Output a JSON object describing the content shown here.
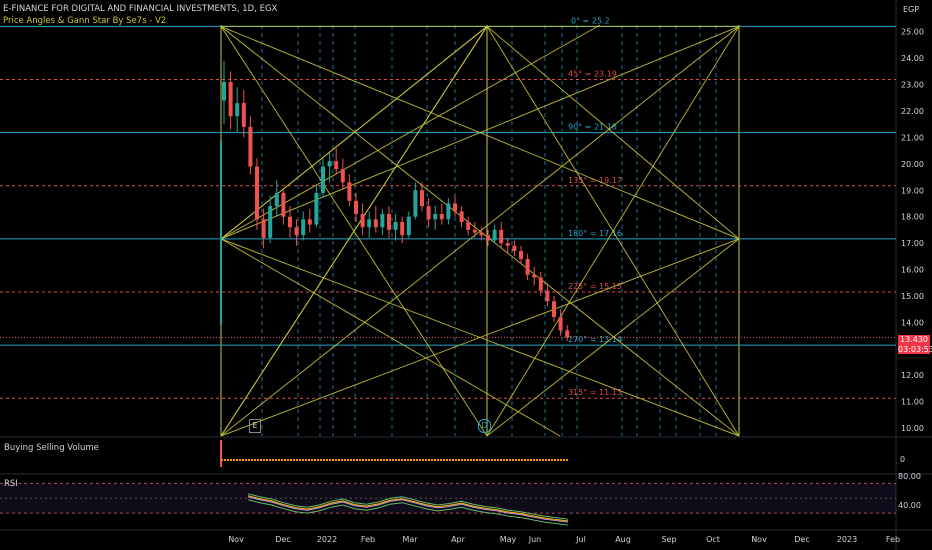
{
  "header": {
    "symbol_title": "E-FINANCE FOR DIGITAL AND FINANCIAL INVESTMENTS, 1D, EGX",
    "indicator_title": "Price Angles & Gann Star By Se7s - V2"
  },
  "currency": "EGP",
  "last_price": {
    "value": "13.430",
    "countdown": "03:03:53"
  },
  "panes": {
    "volume_label": "Buying Selling Volume",
    "volume_zero": "0",
    "rsi_label": "RSI",
    "rsi_ticks": [
      "80.00",
      "40.00"
    ]
  },
  "markers": {
    "event_e": "E",
    "event_d": "D"
  },
  "colors": {
    "background": "#000000",
    "gann_yellow": "#c8c83a",
    "cyan": "#26a6c8",
    "red_dash": "#e04a4a",
    "up": "#26a69a",
    "down": "#ef5350",
    "rsi_purple": "#7e57c2"
  },
  "chart_data": {
    "type": "candlestick",
    "title": "E-FINANCE FOR DIGITAL AND FINANCIAL INVESTMENTS, 1D, EGX",
    "y_unit": "EGP",
    "ylim": [
      9.7,
      26.2
    ],
    "y_ticks": [
      10,
      11,
      12,
      13,
      14,
      15,
      16,
      17,
      18,
      19,
      20,
      21,
      22,
      23,
      24,
      25
    ],
    "x_ticks": [
      "Nov",
      "Dec",
      "2022",
      "Feb",
      "Mar",
      "Apr",
      "May",
      "Jun",
      "Jul",
      "Aug",
      "Sep",
      "Oct",
      "Nov",
      "Dec",
      "2023",
      "Feb"
    ],
    "gann_levels": [
      {
        "label": "0° = 25.2",
        "value": 25.2,
        "color": "#26a6c8",
        "style": "solid"
      },
      {
        "label": "45° = 23.19",
        "value": 23.19,
        "color": "#e04a4a",
        "style": "dashed"
      },
      {
        "label": "90° = 21.18",
        "value": 21.18,
        "color": "#26a6c8",
        "style": "solid"
      },
      {
        "label": "135° = 19.17",
        "value": 19.17,
        "color": "#e04a4a",
        "style": "dashed"
      },
      {
        "label": "180° = 17.16",
        "value": 17.16,
        "color": "#26a6c8",
        "style": "solid"
      },
      {
        "label": "225° = 15.15",
        "value": 15.15,
        "color": "#e04a4a",
        "style": "dashed"
      },
      {
        "label": "270° = 13.14",
        "value": 13.14,
        "color": "#26a6c8",
        "style": "solid"
      },
      {
        "label": "315° = 11.13",
        "value": 11.13,
        "color": "#e04a4a",
        "style": "dashed"
      }
    ],
    "price_series": [
      {
        "x": 0,
        "o": 22.4,
        "h": 23.9,
        "l": 21.5,
        "c": 23.1
      },
      {
        "x": 3,
        "o": 23.1,
        "h": 23.5,
        "l": 21.3,
        "c": 21.8
      },
      {
        "x": 6,
        "o": 21.8,
        "h": 22.9,
        "l": 21.2,
        "c": 22.3
      },
      {
        "x": 9,
        "o": 22.3,
        "h": 22.8,
        "l": 21.0,
        "c": 21.4
      },
      {
        "x": 12,
        "o": 21.4,
        "h": 21.8,
        "l": 19.6,
        "c": 19.9
      },
      {
        "x": 15,
        "o": 19.9,
        "h": 20.2,
        "l": 17.5,
        "c": 17.9
      },
      {
        "x": 18,
        "o": 17.9,
        "h": 18.3,
        "l": 16.8,
        "c": 17.2
      },
      {
        "x": 21,
        "o": 17.2,
        "h": 18.8,
        "l": 17.0,
        "c": 18.4
      },
      {
        "x": 24,
        "o": 18.4,
        "h": 19.4,
        "l": 18.0,
        "c": 18.9
      },
      {
        "x": 27,
        "o": 18.9,
        "h": 19.0,
        "l": 17.7,
        "c": 18.0
      },
      {
        "x": 30,
        "o": 18.0,
        "h": 18.4,
        "l": 17.2,
        "c": 17.6
      },
      {
        "x": 33,
        "o": 17.6,
        "h": 17.9,
        "l": 16.9,
        "c": 17.3
      },
      {
        "x": 36,
        "o": 17.3,
        "h": 18.2,
        "l": 17.1,
        "c": 17.9
      },
      {
        "x": 39,
        "o": 17.9,
        "h": 18.3,
        "l": 17.4,
        "c": 17.7
      },
      {
        "x": 42,
        "o": 17.7,
        "h": 19.2,
        "l": 17.6,
        "c": 18.9
      },
      {
        "x": 45,
        "o": 18.9,
        "h": 20.2,
        "l": 18.7,
        "c": 19.9
      },
      {
        "x": 48,
        "o": 19.9,
        "h": 20.4,
        "l": 19.3,
        "c": 20.1
      },
      {
        "x": 51,
        "o": 20.1,
        "h": 20.6,
        "l": 19.6,
        "c": 19.8
      },
      {
        "x": 54,
        "o": 19.8,
        "h": 20.2,
        "l": 19.0,
        "c": 19.3
      },
      {
        "x": 57,
        "o": 19.3,
        "h": 19.6,
        "l": 18.4,
        "c": 18.6
      },
      {
        "x": 60,
        "o": 18.6,
        "h": 18.9,
        "l": 17.8,
        "c": 18.1
      },
      {
        "x": 63,
        "o": 18.1,
        "h": 18.5,
        "l": 17.3,
        "c": 17.6
      },
      {
        "x": 66,
        "o": 17.6,
        "h": 18.2,
        "l": 17.2,
        "c": 17.9
      },
      {
        "x": 69,
        "o": 17.9,
        "h": 18.4,
        "l": 17.4,
        "c": 17.6
      },
      {
        "x": 72,
        "o": 17.6,
        "h": 18.3,
        "l": 17.3,
        "c": 18.1
      },
      {
        "x": 75,
        "o": 18.1,
        "h": 18.4,
        "l": 17.2,
        "c": 17.5
      },
      {
        "x": 78,
        "o": 17.5,
        "h": 18.1,
        "l": 17.1,
        "c": 17.8
      },
      {
        "x": 81,
        "o": 17.8,
        "h": 18.0,
        "l": 17.0,
        "c": 17.3
      },
      {
        "x": 84,
        "o": 17.3,
        "h": 18.2,
        "l": 17.2,
        "c": 18.0
      },
      {
        "x": 87,
        "o": 18.0,
        "h": 19.3,
        "l": 17.9,
        "c": 19.0
      },
      {
        "x": 90,
        "o": 19.0,
        "h": 19.3,
        "l": 18.2,
        "c": 18.4
      },
      {
        "x": 93,
        "o": 18.4,
        "h": 18.7,
        "l": 17.6,
        "c": 17.9
      },
      {
        "x": 96,
        "o": 17.9,
        "h": 18.4,
        "l": 17.5,
        "c": 18.1
      },
      {
        "x": 99,
        "o": 18.1,
        "h": 18.5,
        "l": 17.7,
        "c": 17.9
      },
      {
        "x": 102,
        "o": 17.9,
        "h": 18.7,
        "l": 17.7,
        "c": 18.5
      },
      {
        "x": 105,
        "o": 18.5,
        "h": 18.8,
        "l": 18.0,
        "c": 18.2
      },
      {
        "x": 108,
        "o": 18.2,
        "h": 18.4,
        "l": 17.6,
        "c": 17.8
      },
      {
        "x": 111,
        "o": 17.8,
        "h": 18.0,
        "l": 17.3,
        "c": 17.5
      },
      {
        "x": 114,
        "o": 17.5,
        "h": 17.8,
        "l": 17.2,
        "c": 17.4
      },
      {
        "x": 117,
        "o": 17.4,
        "h": 17.6,
        "l": 17.1,
        "c": 17.3
      },
      {
        "x": 120,
        "o": 17.3,
        "h": 17.5,
        "l": 16.9,
        "c": 17.1
      },
      {
        "x": 123,
        "o": 17.1,
        "h": 17.7,
        "l": 17.0,
        "c": 17.5
      },
      {
        "x": 126,
        "o": 17.5,
        "h": 17.8,
        "l": 16.8,
        "c": 17.0
      },
      {
        "x": 129,
        "o": 17.0,
        "h": 17.2,
        "l": 16.6,
        "c": 16.9
      },
      {
        "x": 132,
        "o": 16.9,
        "h": 17.1,
        "l": 16.5,
        "c": 16.7
      },
      {
        "x": 135,
        "o": 16.7,
        "h": 16.9,
        "l": 16.2,
        "c": 16.4
      },
      {
        "x": 138,
        "o": 16.4,
        "h": 16.6,
        "l": 15.6,
        "c": 15.8
      },
      {
        "x": 141,
        "o": 15.8,
        "h": 16.1,
        "l": 15.4,
        "c": 15.7
      },
      {
        "x": 144,
        "o": 15.7,
        "h": 15.9,
        "l": 15.0,
        "c": 15.2
      },
      {
        "x": 147,
        "o": 15.2,
        "h": 15.5,
        "l": 14.6,
        "c": 14.8
      },
      {
        "x": 150,
        "o": 14.8,
        "h": 15.0,
        "l": 14.0,
        "c": 14.2
      },
      {
        "x": 153,
        "o": 14.2,
        "h": 14.5,
        "l": 13.5,
        "c": 13.7
      },
      {
        "x": 156,
        "o": 13.7,
        "h": 13.9,
        "l": 13.3,
        "c": 13.43
      }
    ],
    "rsi_series": [
      62,
      58,
      55,
      50,
      46,
      44,
      47,
      52,
      55,
      50,
      48,
      51,
      56,
      58,
      54,
      50,
      47,
      49,
      52,
      48,
      45,
      43,
      40,
      38,
      35,
      32,
      30,
      28
    ],
    "rsi_ylim": [
      20,
      90
    ],
    "rsi_bands": [
      80,
      40
    ]
  }
}
